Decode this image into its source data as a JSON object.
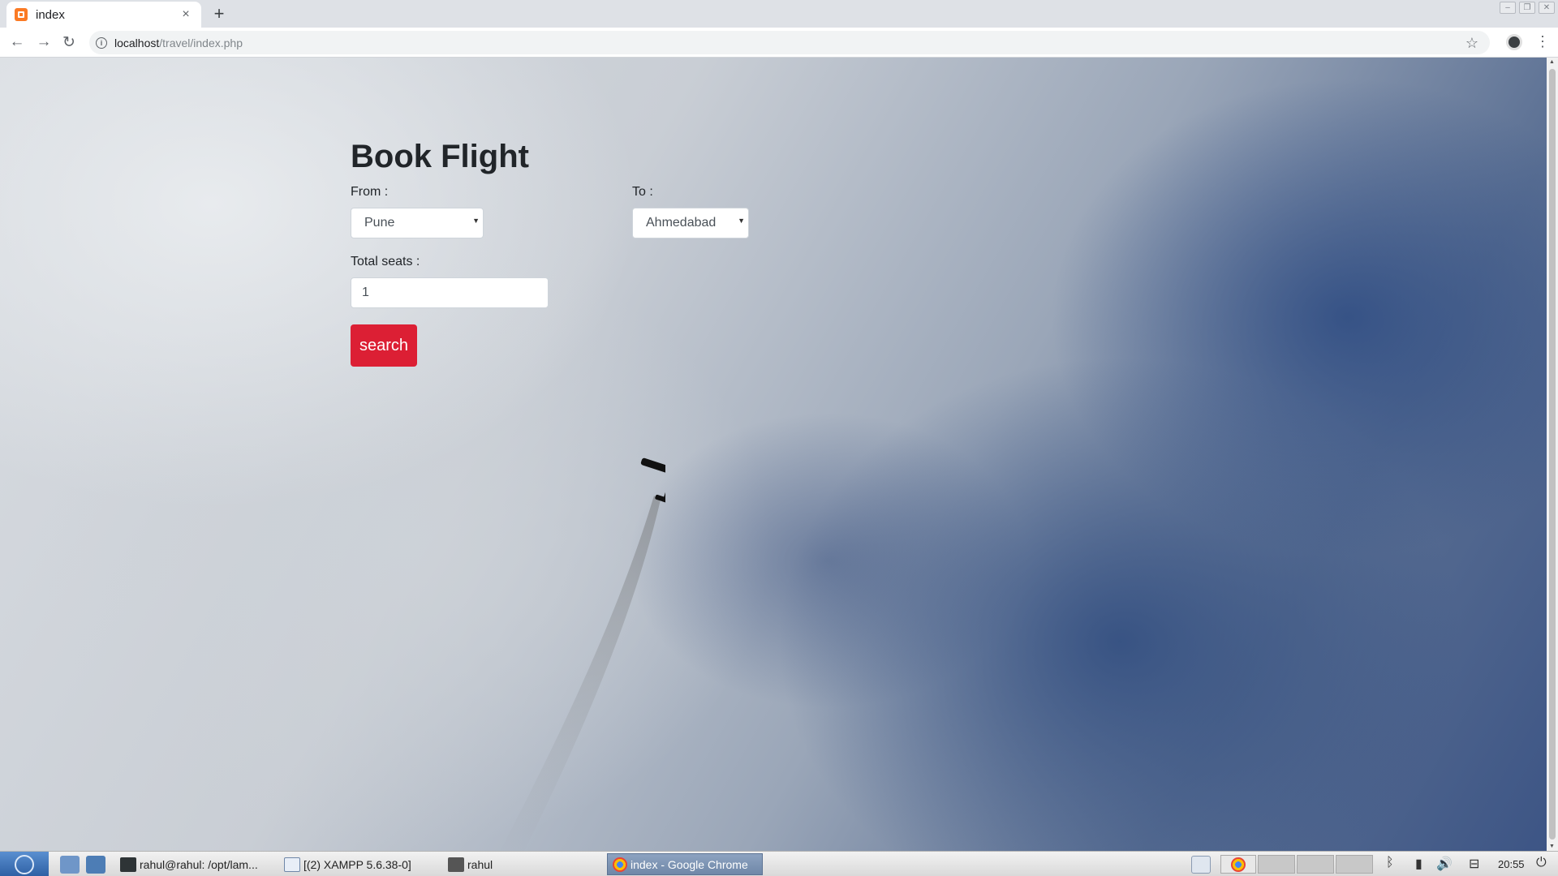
{
  "browser": {
    "tab_title": "index",
    "tab_close": "×",
    "new_tab": "+",
    "url_host": "localhost",
    "url_path": "/travel/index.php",
    "back": "←",
    "forward": "→",
    "reload": "↻",
    "star": "☆",
    "menu": "⋮",
    "info": "i"
  },
  "page": {
    "heading": "Book Flight",
    "from_label": "From :",
    "from_value": "Pune",
    "to_label": "To :",
    "to_value": "Ahmedabad",
    "seats_label": "Total seats :",
    "seats_value": "1",
    "search_button": "search"
  },
  "taskbar": {
    "tasks": [
      "rahul@rahul: /opt/lam...",
      "[(2) XAMPP 5.6.38-0]",
      "rahul",
      "index - Google Chrome"
    ],
    "clock": "20:55"
  },
  "colors": {
    "search_button": "#dc1f34",
    "favicon": "#fb7a24"
  }
}
